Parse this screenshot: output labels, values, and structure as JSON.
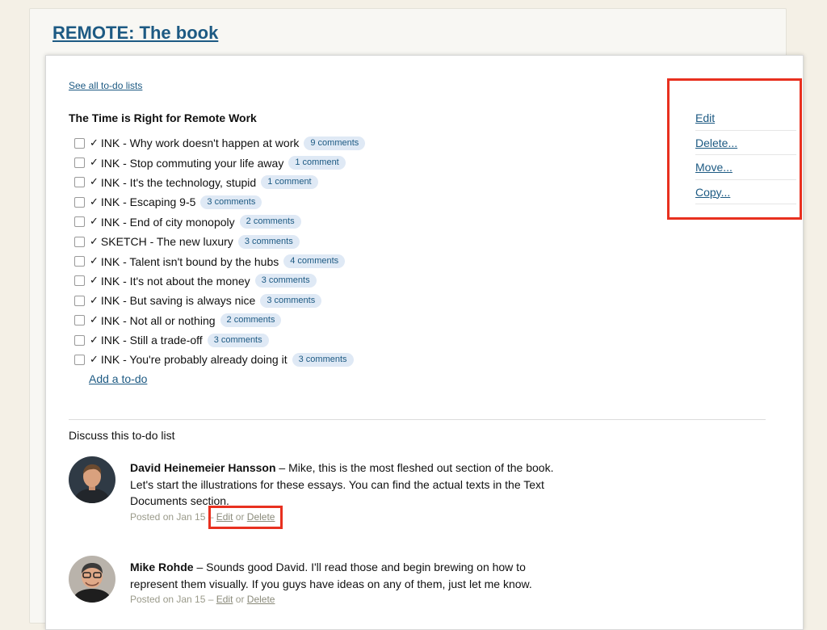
{
  "project": {
    "title": "REMOTE: The book"
  },
  "nav": {
    "see_all": "See all to-do lists"
  },
  "list": {
    "title": "The Time is Right for Remote Work",
    "check_glyph": "✓",
    "todos": [
      {
        "text": "INK - Why work doesn't happen at work",
        "comments": "9 comments"
      },
      {
        "text": "INK - Stop commuting your life away",
        "comments": "1 comment"
      },
      {
        "text": "INK - It's the technology, stupid",
        "comments": "1 comment"
      },
      {
        "text": "INK - Escaping 9-5",
        "comments": "3 comments"
      },
      {
        "text": "INK - End of city monopoly",
        "comments": "2 comments"
      },
      {
        "text": "SKETCH - The new luxury",
        "comments": "3 comments"
      },
      {
        "text": "INK - Talent isn't bound by the hubs",
        "comments": "4 comments"
      },
      {
        "text": "INK - It's not about the money",
        "comments": "3 comments"
      },
      {
        "text": "INK - But saving is always nice",
        "comments": "3 comments"
      },
      {
        "text": "INK - Not all or nothing",
        "comments": "2 comments"
      },
      {
        "text": "INK - Still a trade-off",
        "comments": "3 comments"
      },
      {
        "text": "INK - You're probably already doing it",
        "comments": "3 comments"
      }
    ],
    "add_todo": "Add a to-do"
  },
  "side_actions": {
    "edit": "Edit",
    "delete": "Delete...",
    "move": "Move...",
    "copy": "Copy..."
  },
  "discussion": {
    "title": "Discuss this to-do list",
    "comments": [
      {
        "author": "David Heinemeier Hansson",
        "text": " – Mike, this is the most fleshed out section of the book. Let's start the illustrations for these essays. You can find the actual texts in the Text Documents section.",
        "posted": "Posted on Jan 15 – ",
        "edit": "Edit",
        "or": " or ",
        "delete": "Delete"
      },
      {
        "author": "Mike Rohde",
        "text": " – Sounds good David. I'll read those and begin brewing on how to represent them visually. If you guys have ideas on any of them, just let me know.",
        "posted": "Posted on Jan 15 – ",
        "edit": "Edit",
        "or": " or ",
        "delete": "Delete"
      }
    ]
  },
  "colors": {
    "link": "#1d5a83",
    "badge_bg": "#dfe9f5",
    "highlight": "#e8301f",
    "page_bg": "#f4f0e6"
  }
}
